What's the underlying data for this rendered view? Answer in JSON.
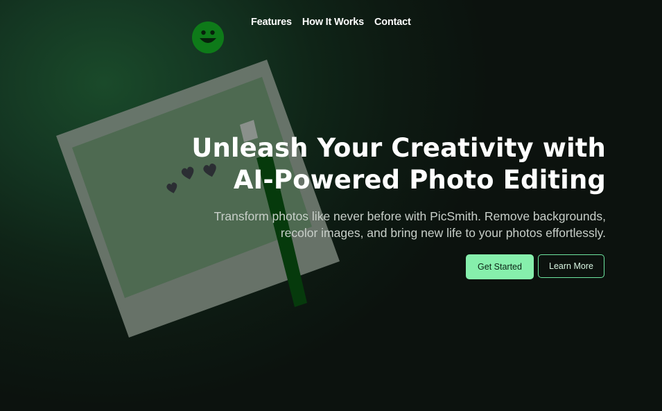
{
  "nav": {
    "items": [
      {
        "label": "Features"
      },
      {
        "label": "How It Works"
      },
      {
        "label": "Contact"
      }
    ]
  },
  "logo": {
    "icon": "smiley-face-icon",
    "color": "#0e7a19"
  },
  "hero": {
    "title_line1": "Unleash Your Creativity with",
    "title_line2": "AI-Powered Photo Editing",
    "subtitle_line1": "Transform photos like never before with PicSmith. Remove backgrounds,",
    "subtitle_line2": "recolor images, and bring new life to your photos effortlessly.",
    "primary_button": "Get Started",
    "secondary_button": "Learn More"
  },
  "colors": {
    "accent": "#86efac",
    "background": "#0c120e",
    "frame": "#6f7a70",
    "photo": "#4e6a51",
    "stick": "#0a3d10"
  },
  "illustration": {
    "frame": "polaroid-frame",
    "icons": [
      "heart-icon",
      "heart-icon",
      "heart-icon"
    ]
  }
}
